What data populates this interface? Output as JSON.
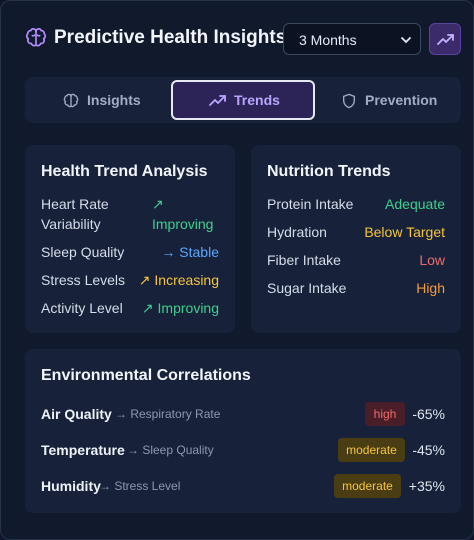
{
  "header": {
    "title": "Predictive Health Insights",
    "period_select": {
      "value": "3 Months"
    }
  },
  "tabs": [
    {
      "label": "Insights",
      "icon": "brain-icon",
      "active": false
    },
    {
      "label": "Trends",
      "icon": "trend-up-icon",
      "active": true
    },
    {
      "label": "Prevention",
      "icon": "shield-icon",
      "active": false
    }
  ],
  "health_trend": {
    "title": "Health Trend Analysis",
    "items": [
      {
        "label_line1": "Heart Rate",
        "label_line2": "Variability",
        "arrow": "↗",
        "status": "Improving",
        "color": "#3fd08a"
      },
      {
        "label": "Sleep Quality",
        "arrow": "→",
        "status": "Stable",
        "color": "#5aa7ff"
      },
      {
        "label": "Stress Levels",
        "arrow": "↗",
        "status": "Increasing",
        "color": "#f5c53d"
      },
      {
        "label": "Activity Level",
        "arrow": "↗",
        "status": "Improving",
        "color": "#3fd08a"
      }
    ]
  },
  "nutrition": {
    "title": "Nutrition Trends",
    "items": [
      {
        "label": "Protein Intake",
        "status": "Adequate",
        "color": "#3fd08a"
      },
      {
        "label": "Hydration",
        "status": "Below Target",
        "color": "#f5c53d"
      },
      {
        "label": "Fiber Intake",
        "status": "Low",
        "color": "#ef6b6b"
      },
      {
        "label": "Sugar Intake",
        "status": "High",
        "color": "#f59a3d"
      }
    ]
  },
  "environment": {
    "title": "Environmental Correlations",
    "items": [
      {
        "factor": "Air Quality",
        "target": "→ Respiratory Rate",
        "level": "high",
        "correlation": "-65%"
      },
      {
        "factor": "Temperature",
        "target": "→ Sleep Quality",
        "level": "moderate",
        "correlation": "-45%"
      },
      {
        "factor": "Humidity",
        "target": "→ Stress Level",
        "level": "moderate",
        "correlation": "+35%"
      }
    ]
  }
}
